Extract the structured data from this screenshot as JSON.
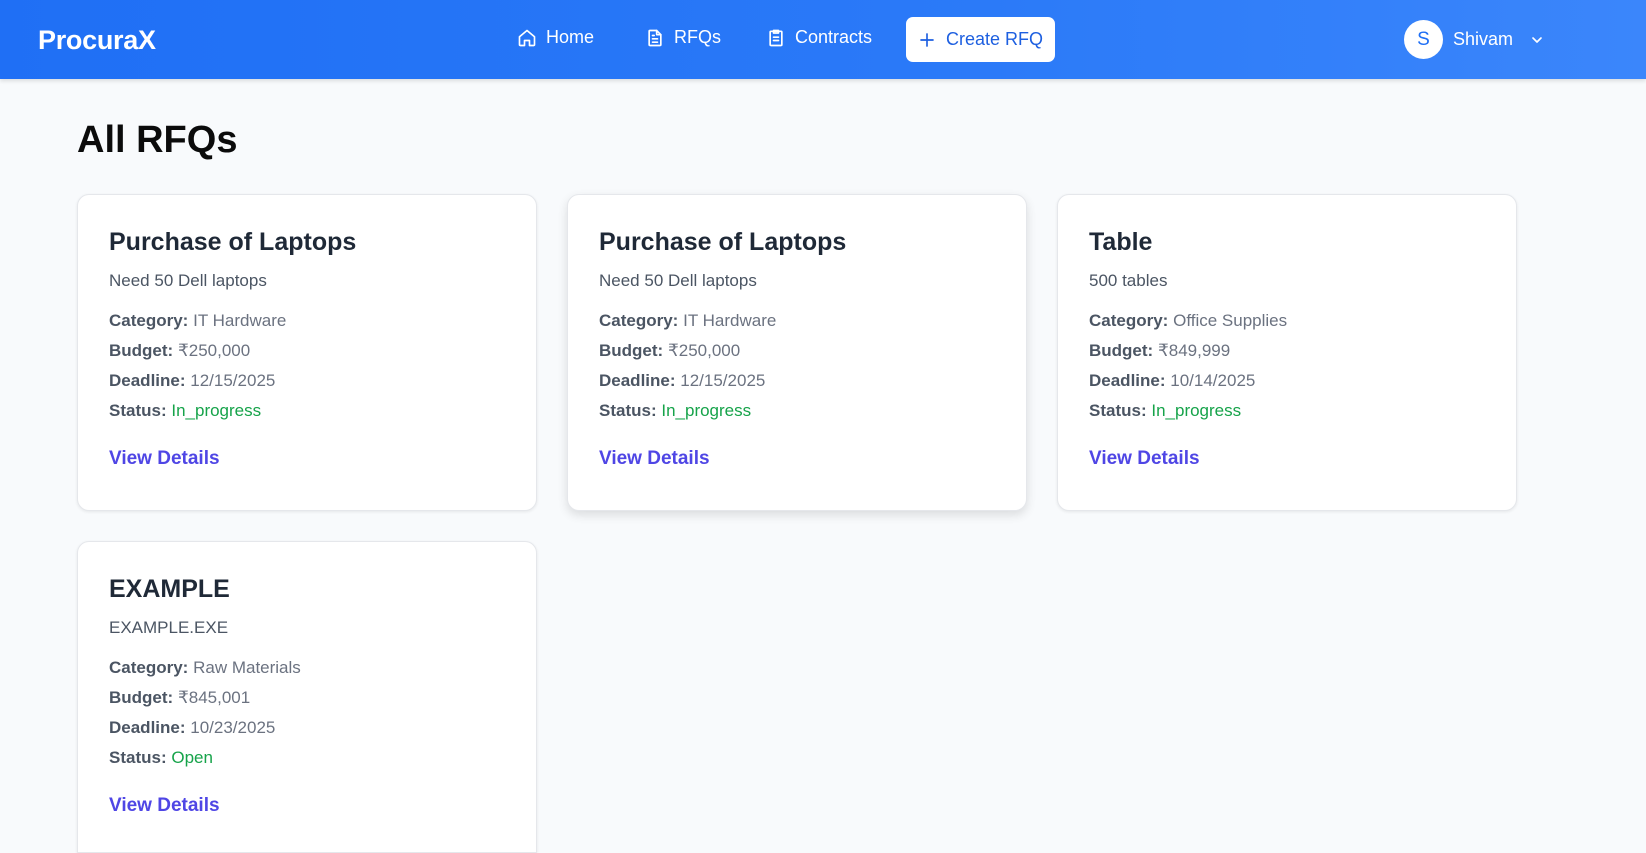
{
  "nav": {
    "logo": "ProcuraX",
    "home": "Home",
    "rfqs": "RFQs",
    "contracts": "Contracts",
    "create": "Create RFQ",
    "user_initial": "S",
    "user_name": "Shivam"
  },
  "page": {
    "title": "All RFQs"
  },
  "labels": {
    "category": "Category:",
    "budget": "Budget:",
    "deadline": "Deadline:",
    "status": "Status:",
    "view": "View Details"
  },
  "rfqs": [
    {
      "title": "Purchase of Laptops",
      "description": "Need 50 Dell laptops",
      "category": "IT Hardware",
      "budget": "₹250,000",
      "deadline": "12/15/2025",
      "status": "In_progress"
    },
    {
      "title": "Purchase of Laptops",
      "description": "Need 50 Dell laptops",
      "category": "IT Hardware",
      "budget": "₹250,000",
      "deadline": "12/15/2025",
      "status": "In_progress"
    },
    {
      "title": "Table",
      "description": "500 tables",
      "category": "Office Supplies",
      "budget": "₹849,999",
      "deadline": "10/14/2025",
      "status": "In_progress"
    },
    {
      "title": "EXAMPLE",
      "description": "EXAMPLE.EXE",
      "category": "Raw Materials",
      "budget": "₹845,001",
      "deadline": "10/23/2025",
      "status": "Open"
    }
  ],
  "colors": {
    "nav": "#1f6ff5",
    "link": "#4f46e5",
    "status": "#16a34a"
  }
}
